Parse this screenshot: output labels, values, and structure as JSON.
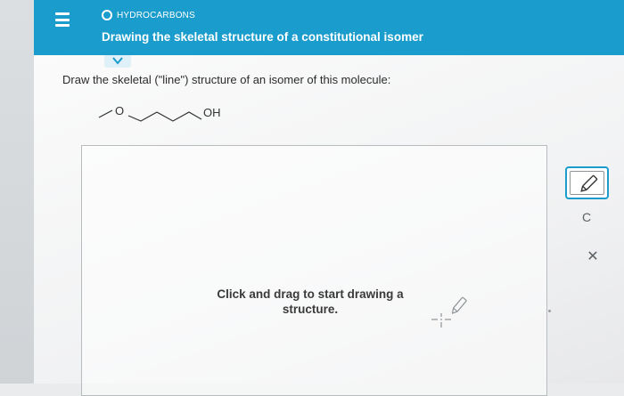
{
  "header": {
    "topic": "HYDROCARBONS",
    "title": "Drawing the skeletal structure of a constitutional isomer"
  },
  "question": {
    "prompt": "Draw the skeletal (\"line\") structure of an isomer of this molecule:",
    "molecule_labels": {
      "oxygen": "O",
      "hydroxyl": "OH"
    }
  },
  "canvas": {
    "hint": "Click and drag to start drawing a structure."
  },
  "toolbar": {
    "tools": [
      "pencil-icon",
      "undo-icon",
      "close-icon"
    ],
    "undo_label": "C",
    "close_label": "✕"
  },
  "colors": {
    "header": "#1a9ccc",
    "accent": "#1a9ccc"
  }
}
